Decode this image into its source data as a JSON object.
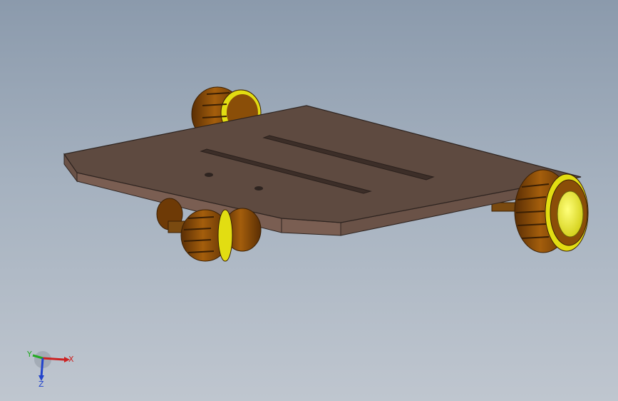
{
  "viewport": {
    "colors": {
      "background_top": "#8b9aac",
      "background_bottom": "#bfc6cf",
      "plate_top": "#5e4a40",
      "plate_side": "#7a5e52",
      "tire": "#8a4e08",
      "rim": "#e2dd12",
      "hub": "#f2ee3a"
    }
  },
  "model": {
    "name_icon": "robot-chassis-model",
    "parts": [
      "base-plate",
      "slot",
      "wheel",
      "axle"
    ]
  },
  "triad": {
    "x_label": "X",
    "y_label": "Y",
    "z_label": "Z",
    "colors": {
      "x": "#cc2222",
      "y": "#22aa22",
      "z": "#2244cc"
    }
  }
}
